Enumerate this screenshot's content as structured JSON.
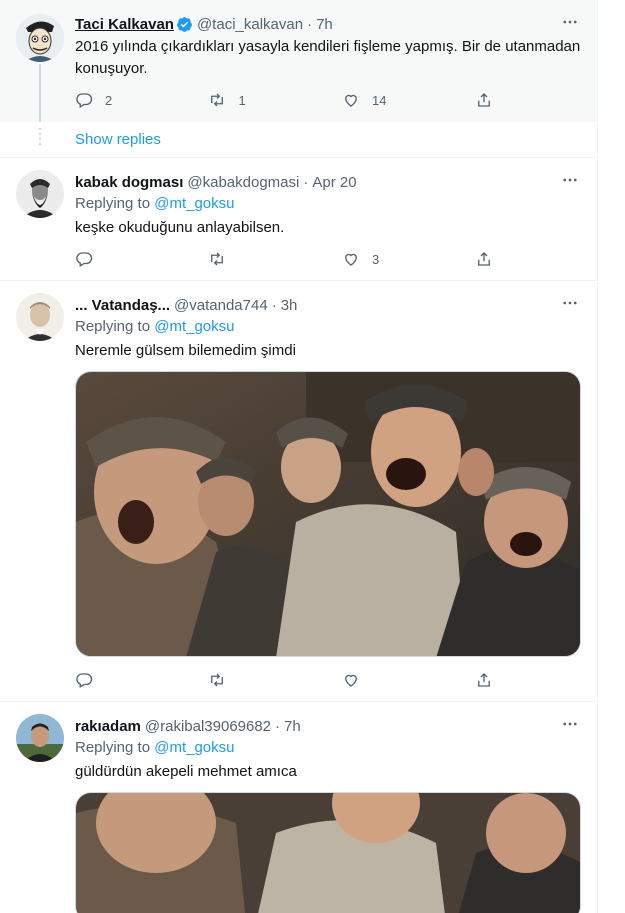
{
  "tweets": [
    {
      "name": "Taci Kalkavan",
      "handle": "@taci_kalkavan",
      "time": "7h",
      "text": "2016 yılında çıkardıkları yasayla kendileri fişleme yapmış. Bir de utanmadan konuşuyor.",
      "replies": "2",
      "retweets": "1",
      "likes": "14"
    },
    {
      "name": "kabak dogması",
      "handle": "@kabakdogmasi",
      "time": "Apr 20",
      "replying_label": "Replying to",
      "replying_to": "@mt_goksu",
      "text": "keşke okuduğunu anlayabilsen.",
      "likes": "3"
    },
    {
      "name": "... Vatandaş...",
      "handle": "@vatanda744",
      "time": "3h",
      "replying_label": "Replying to",
      "replying_to": "@mt_goksu",
      "text": "Neremle gülsem bilemedim şimdi"
    },
    {
      "name": "rakıadam",
      "handle": "@rakibal39069682",
      "time": "7h",
      "replying_label": "Replying to",
      "replying_to": "@mt_goksu",
      "text": "güldürdün akepeli mehmet amıca"
    }
  ],
  "show_replies": "Show replies",
  "separator": "·",
  "icons": {
    "verified": "verified-badge-icon",
    "more": "more-icon",
    "reply": "reply-icon",
    "retweet": "retweet-icon",
    "like": "like-icon",
    "share": "share-icon"
  },
  "colors": {
    "accent": "#1d9bf0",
    "secondary_text": "#536471",
    "highlight_bg": "#f7f9f9"
  }
}
